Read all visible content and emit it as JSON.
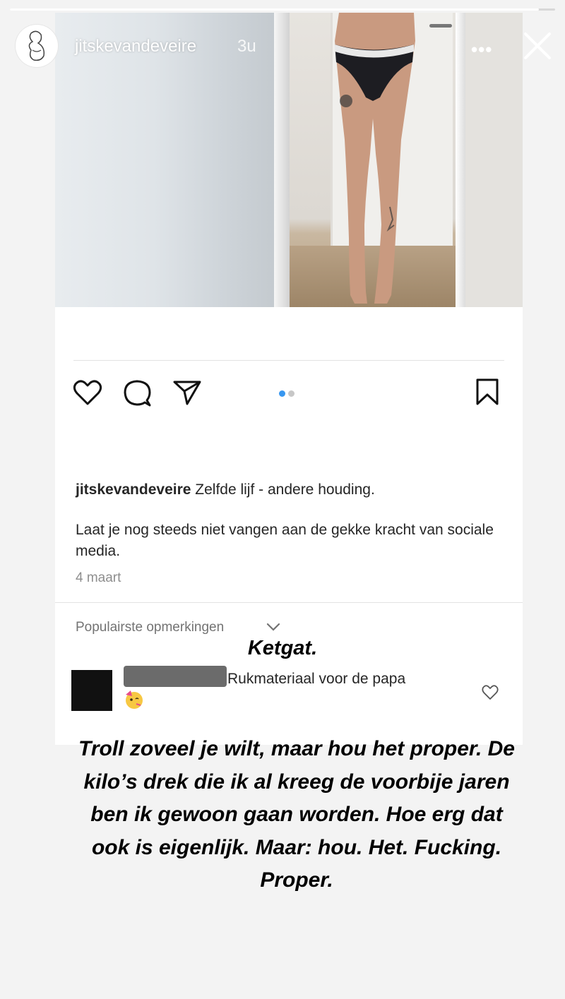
{
  "story": {
    "progress": 0.97,
    "username": "jitskevandeveire",
    "time": "3u",
    "more_icon": "more-horizontal-icon",
    "close_icon": "close-icon"
  },
  "post": {
    "actions": [
      "heart-icon",
      "comment-icon",
      "share-icon",
      "bookmark-icon"
    ],
    "carousel": {
      "count": 2,
      "active": 0
    },
    "caption_user": "jitskevandeveire",
    "caption_title": "Zelfde lijf - andere houding.",
    "caption_body": "Laat je nog steeds niet vangen aan de gekke kracht van sociale media.",
    "date": "4 maart",
    "comments_sort": "Populairste opmerkingen",
    "comment_text": "Rukmateriaal voor de papa",
    "comment_emoji": "🥳"
  },
  "overlay": {
    "headline": "Ketgat.",
    "message": "Troll zoveel je wilt, maar hou het proper. De kilo’s drek die ik al kreeg de voorbije jaren ben ik gewoon gaan worden. Hoe erg dat ook is eigenlijk. Maar: hou. Het. Fucking. Proper."
  },
  "colors": {
    "text": "#262626",
    "muted": "#8e8e8e",
    "dot_active": "#3897f0",
    "dot_inactive": "#c7c7c7"
  }
}
